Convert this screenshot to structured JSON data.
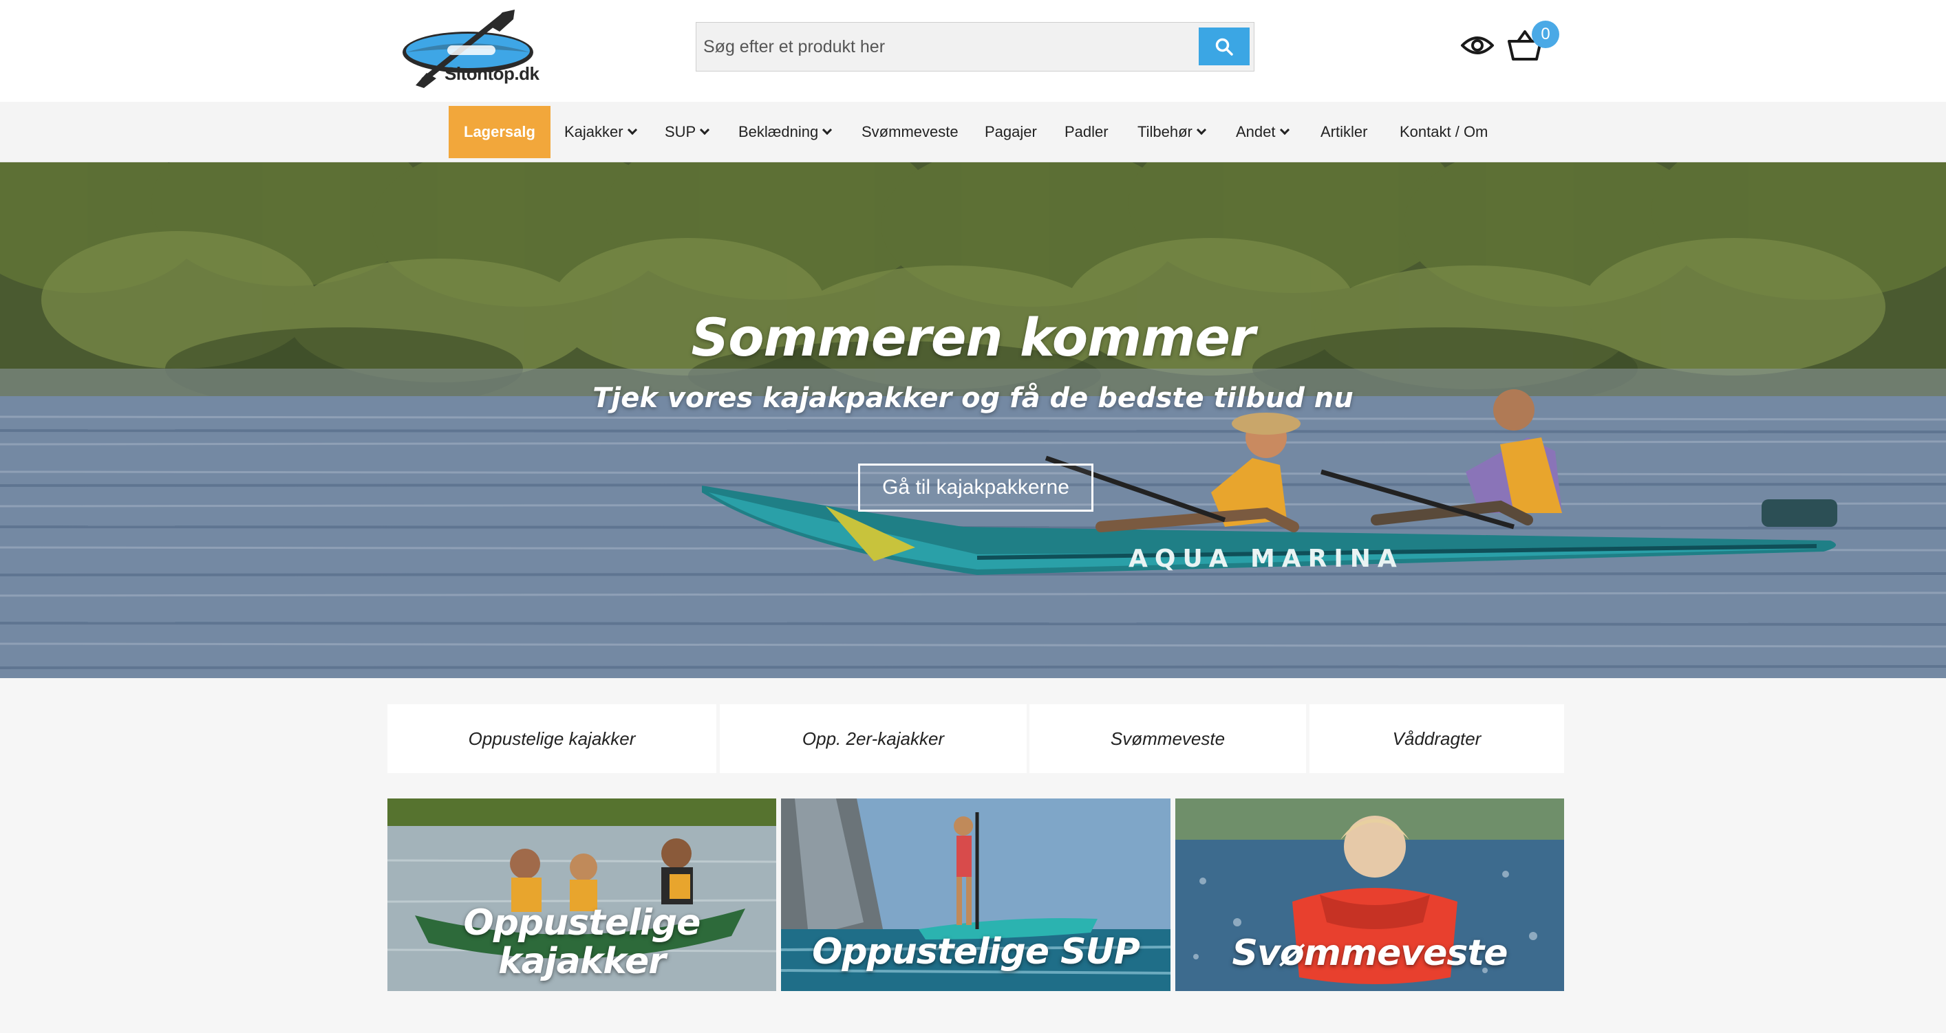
{
  "header": {
    "logo_text": "Sitontop.dk",
    "search_placeholder": "Søg efter et produkt her",
    "cart_count": "0"
  },
  "nav": {
    "items": [
      {
        "label": "Lagersalg",
        "dropdown": false
      },
      {
        "label": "Kajakker",
        "dropdown": true
      },
      {
        "label": "SUP",
        "dropdown": true
      },
      {
        "label": "Beklædning",
        "dropdown": true
      },
      {
        "label": "Svømmeveste",
        "dropdown": false
      },
      {
        "label": "Pagajer",
        "dropdown": false
      },
      {
        "label": "Padler",
        "dropdown": false
      },
      {
        "label": "Tilbehør",
        "dropdown": true
      },
      {
        "label": "Andet",
        "dropdown": true
      },
      {
        "label": "Artikler",
        "dropdown": false
      },
      {
        "label": "Kontakt / Om",
        "dropdown": false
      }
    ]
  },
  "hero": {
    "title": "Sommeren kommer",
    "subtitle": "Tjek vores kajakpakker og få de bedste tilbud nu",
    "button_label": "Gå til kajakpakkerne",
    "kayak_brand": "AQUA MARINA"
  },
  "categories": [
    {
      "label": "Oppustelige kajakker"
    },
    {
      "label": "Opp. 2er-kajakker"
    },
    {
      "label": "Svømmeveste"
    },
    {
      "label": "Våddragter"
    }
  ],
  "tiles": [
    {
      "line1": "Oppustelige",
      "line2": "kajakker"
    },
    {
      "line1": "Oppustelige SUP",
      "line2": ""
    },
    {
      "line1": "Svømmeveste",
      "line2": ""
    }
  ],
  "colors": {
    "accent_orange": "#f2a73b",
    "accent_blue": "#3ba6e4",
    "nav_bg": "#f4f4f4",
    "page_bg": "#f6f6f6"
  },
  "icons": [
    "kayak-paddle-logo",
    "search-icon",
    "eye-icon",
    "basket-icon",
    "chevron-down-icon"
  ]
}
